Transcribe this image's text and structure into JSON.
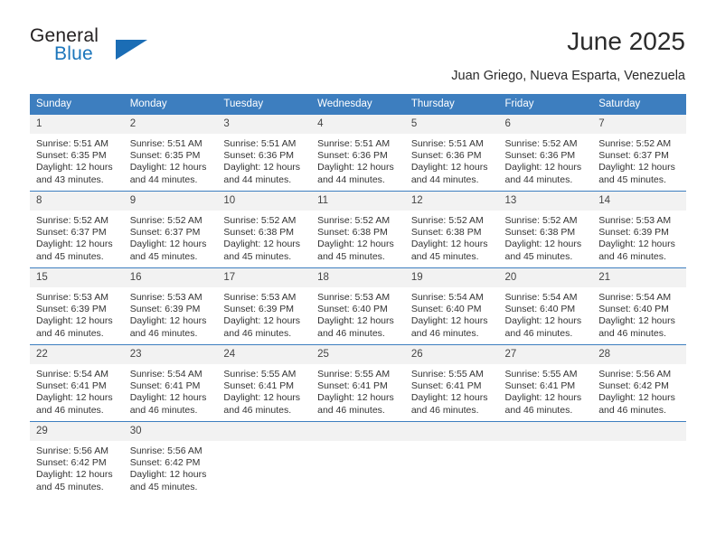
{
  "brand": {
    "name_part1": "General",
    "name_part2": "Blue",
    "flag_icon": "triangle-flag-icon"
  },
  "header": {
    "title": "June 2025",
    "location": "Juan Griego, Nueva Esparta, Venezuela"
  },
  "colors": {
    "header_blue": "#3d7ebf",
    "brand_blue": "#1b75bb",
    "day_band_gray": "#f2f2f2",
    "text": "#333333"
  },
  "calendar": {
    "weekday_headers": [
      "Sunday",
      "Monday",
      "Tuesday",
      "Wednesday",
      "Thursday",
      "Friday",
      "Saturday"
    ],
    "weeks": [
      [
        {
          "day": "1",
          "sunrise": "Sunrise: 5:51 AM",
          "sunset": "Sunset: 6:35 PM",
          "daylight": "Daylight: 12 hours and 43 minutes."
        },
        {
          "day": "2",
          "sunrise": "Sunrise: 5:51 AM",
          "sunset": "Sunset: 6:35 PM",
          "daylight": "Daylight: 12 hours and 44 minutes."
        },
        {
          "day": "3",
          "sunrise": "Sunrise: 5:51 AM",
          "sunset": "Sunset: 6:36 PM",
          "daylight": "Daylight: 12 hours and 44 minutes."
        },
        {
          "day": "4",
          "sunrise": "Sunrise: 5:51 AM",
          "sunset": "Sunset: 6:36 PM",
          "daylight": "Daylight: 12 hours and 44 minutes."
        },
        {
          "day": "5",
          "sunrise": "Sunrise: 5:51 AM",
          "sunset": "Sunset: 6:36 PM",
          "daylight": "Daylight: 12 hours and 44 minutes."
        },
        {
          "day": "6",
          "sunrise": "Sunrise: 5:52 AM",
          "sunset": "Sunset: 6:36 PM",
          "daylight": "Daylight: 12 hours and 44 minutes."
        },
        {
          "day": "7",
          "sunrise": "Sunrise: 5:52 AM",
          "sunset": "Sunset: 6:37 PM",
          "daylight": "Daylight: 12 hours and 45 minutes."
        }
      ],
      [
        {
          "day": "8",
          "sunrise": "Sunrise: 5:52 AM",
          "sunset": "Sunset: 6:37 PM",
          "daylight": "Daylight: 12 hours and 45 minutes."
        },
        {
          "day": "9",
          "sunrise": "Sunrise: 5:52 AM",
          "sunset": "Sunset: 6:37 PM",
          "daylight": "Daylight: 12 hours and 45 minutes."
        },
        {
          "day": "10",
          "sunrise": "Sunrise: 5:52 AM",
          "sunset": "Sunset: 6:38 PM",
          "daylight": "Daylight: 12 hours and 45 minutes."
        },
        {
          "day": "11",
          "sunrise": "Sunrise: 5:52 AM",
          "sunset": "Sunset: 6:38 PM",
          "daylight": "Daylight: 12 hours and 45 minutes."
        },
        {
          "day": "12",
          "sunrise": "Sunrise: 5:52 AM",
          "sunset": "Sunset: 6:38 PM",
          "daylight": "Daylight: 12 hours and 45 minutes."
        },
        {
          "day": "13",
          "sunrise": "Sunrise: 5:52 AM",
          "sunset": "Sunset: 6:38 PM",
          "daylight": "Daylight: 12 hours and 45 minutes."
        },
        {
          "day": "14",
          "sunrise": "Sunrise: 5:53 AM",
          "sunset": "Sunset: 6:39 PM",
          "daylight": "Daylight: 12 hours and 46 minutes."
        }
      ],
      [
        {
          "day": "15",
          "sunrise": "Sunrise: 5:53 AM",
          "sunset": "Sunset: 6:39 PM",
          "daylight": "Daylight: 12 hours and 46 minutes."
        },
        {
          "day": "16",
          "sunrise": "Sunrise: 5:53 AM",
          "sunset": "Sunset: 6:39 PM",
          "daylight": "Daylight: 12 hours and 46 minutes."
        },
        {
          "day": "17",
          "sunrise": "Sunrise: 5:53 AM",
          "sunset": "Sunset: 6:39 PM",
          "daylight": "Daylight: 12 hours and 46 minutes."
        },
        {
          "day": "18",
          "sunrise": "Sunrise: 5:53 AM",
          "sunset": "Sunset: 6:40 PM",
          "daylight": "Daylight: 12 hours and 46 minutes."
        },
        {
          "day": "19",
          "sunrise": "Sunrise: 5:54 AM",
          "sunset": "Sunset: 6:40 PM",
          "daylight": "Daylight: 12 hours and 46 minutes."
        },
        {
          "day": "20",
          "sunrise": "Sunrise: 5:54 AM",
          "sunset": "Sunset: 6:40 PM",
          "daylight": "Daylight: 12 hours and 46 minutes."
        },
        {
          "day": "21",
          "sunrise": "Sunrise: 5:54 AM",
          "sunset": "Sunset: 6:40 PM",
          "daylight": "Daylight: 12 hours and 46 minutes."
        }
      ],
      [
        {
          "day": "22",
          "sunrise": "Sunrise: 5:54 AM",
          "sunset": "Sunset: 6:41 PM",
          "daylight": "Daylight: 12 hours and 46 minutes."
        },
        {
          "day": "23",
          "sunrise": "Sunrise: 5:54 AM",
          "sunset": "Sunset: 6:41 PM",
          "daylight": "Daylight: 12 hours and 46 minutes."
        },
        {
          "day": "24",
          "sunrise": "Sunrise: 5:55 AM",
          "sunset": "Sunset: 6:41 PM",
          "daylight": "Daylight: 12 hours and 46 minutes."
        },
        {
          "day": "25",
          "sunrise": "Sunrise: 5:55 AM",
          "sunset": "Sunset: 6:41 PM",
          "daylight": "Daylight: 12 hours and 46 minutes."
        },
        {
          "day": "26",
          "sunrise": "Sunrise: 5:55 AM",
          "sunset": "Sunset: 6:41 PM",
          "daylight": "Daylight: 12 hours and 46 minutes."
        },
        {
          "day": "27",
          "sunrise": "Sunrise: 5:55 AM",
          "sunset": "Sunset: 6:41 PM",
          "daylight": "Daylight: 12 hours and 46 minutes."
        },
        {
          "day": "28",
          "sunrise": "Sunrise: 5:56 AM",
          "sunset": "Sunset: 6:42 PM",
          "daylight": "Daylight: 12 hours and 46 minutes."
        }
      ],
      [
        {
          "day": "29",
          "sunrise": "Sunrise: 5:56 AM",
          "sunset": "Sunset: 6:42 PM",
          "daylight": "Daylight: 12 hours and 45 minutes."
        },
        {
          "day": "30",
          "sunrise": "Sunrise: 5:56 AM",
          "sunset": "Sunset: 6:42 PM",
          "daylight": "Daylight: 12 hours and 45 minutes."
        },
        {
          "day": "",
          "sunrise": "",
          "sunset": "",
          "daylight": ""
        },
        {
          "day": "",
          "sunrise": "",
          "sunset": "",
          "daylight": ""
        },
        {
          "day": "",
          "sunrise": "",
          "sunset": "",
          "daylight": ""
        },
        {
          "day": "",
          "sunrise": "",
          "sunset": "",
          "daylight": ""
        },
        {
          "day": "",
          "sunrise": "",
          "sunset": "",
          "daylight": ""
        }
      ]
    ]
  }
}
